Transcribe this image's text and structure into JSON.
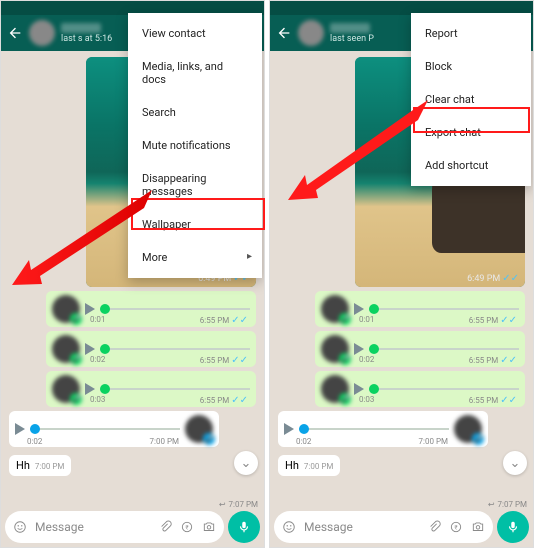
{
  "colors": {
    "header": "#075e54",
    "accent": "#00bfa5",
    "tick": "#4fc3f7",
    "bubble_out": "#dcf8c6"
  },
  "left": {
    "status_time": "",
    "last_seen": "last s             at 5:16",
    "image": {
      "time": "6:49 PM"
    },
    "voices": [
      {
        "dur": "0:01",
        "time": "6:55 PM"
      },
      {
        "dur": "0:02",
        "time": "6:55 PM"
      },
      {
        "dur": "0:03",
        "time": "6:55 PM"
      }
    ],
    "voice_in": {
      "dur": "0:02",
      "time": "7:00 PM"
    },
    "text_msg": {
      "body": "Hh",
      "time": "7:00 PM"
    },
    "reply_hint": "7:07 PM",
    "menu": [
      "View contact",
      "Media, links, and docs",
      "Search",
      "Mute notifications",
      "Disappearing messages",
      "Wallpaper",
      "More"
    ],
    "input_placeholder": "Message"
  },
  "right": {
    "last_seen": "last seen          P",
    "image": {
      "time": "6:49 PM"
    },
    "voices": [
      {
        "dur": "0:01",
        "time": "6:55 PM"
      },
      {
        "dur": "0:02",
        "time": "6:55 PM"
      },
      {
        "dur": "0:03",
        "time": "6:55 PM"
      }
    ],
    "voice_in": {
      "dur": "0:02",
      "time": "7:00 PM"
    },
    "text_msg": {
      "body": "Hh",
      "time": "7:00 PM"
    },
    "reply_hint": "7:07 PM",
    "menu": [
      "Report",
      "Block",
      "Clear chat",
      "Export chat",
      "Add shortcut"
    ],
    "input_placeholder": "Message"
  },
  "ticks": "✓✓"
}
